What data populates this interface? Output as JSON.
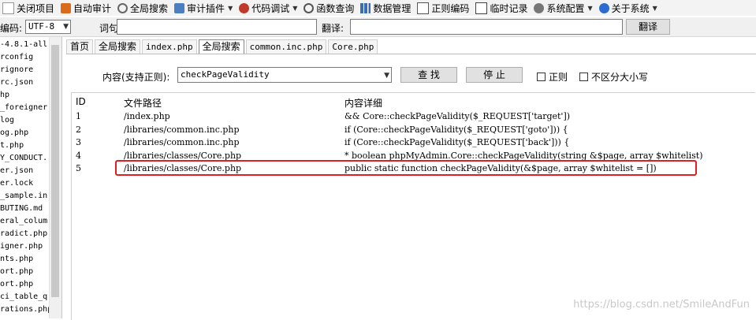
{
  "menu": [
    {
      "label": "关闭项目",
      "icon": "close-project-icon",
      "caret": false
    },
    {
      "label": "自动审计",
      "icon": "auto-audit-icon",
      "caret": false
    },
    {
      "label": "全局搜索",
      "icon": "global-search-icon",
      "caret": false
    },
    {
      "label": "审计插件",
      "icon": "plugin-icon",
      "caret": true
    },
    {
      "label": "代码调试",
      "icon": "code-debug-icon",
      "caret": true
    },
    {
      "label": "函数查询",
      "icon": "function-search-icon",
      "caret": false
    },
    {
      "label": "数据管理",
      "icon": "data-manage-icon",
      "caret": false
    },
    {
      "label": "正则编码",
      "icon": "regex-icon",
      "caret": false
    },
    {
      "label": "临时记录",
      "icon": "notes-icon",
      "caret": false
    },
    {
      "label": "系统配置",
      "icon": "gear-icon",
      "caret": true
    },
    {
      "label": "关于系统",
      "icon": "info-icon",
      "caret": true
    }
  ],
  "toolbar": {
    "encoding_label": "编码:",
    "encoding_value": "UTF-8",
    "word_label": "词句:",
    "translate_label": "翻译:",
    "translate_button": "翻译"
  },
  "sidebar": {
    "files": [
      "-4.8.1-all",
      "rconfig",
      "rignore",
      "rc.json",
      "hp",
      "_foreigner",
      "log",
      "og.php",
      "t.php",
      "Y_CONDUCT.r",
      "er.json",
      "er.lock",
      "_sample.in",
      "BUTING.md",
      "eral_colum",
      "radict.php",
      "igner.php",
      "nts.php",
      "ort.php",
      "ort.php",
      "ci_table_q",
      "rations.php"
    ]
  },
  "tabs": [
    {
      "label": "首页",
      "mono": false,
      "active": false
    },
    {
      "label": "全局搜索",
      "mono": false,
      "active": false
    },
    {
      "label": "index.php",
      "mono": true,
      "active": false
    },
    {
      "label": "全局搜索",
      "mono": false,
      "active": true
    },
    {
      "label": "common.inc.php",
      "mono": true,
      "active": false
    },
    {
      "label": "Core.php",
      "mono": true,
      "active": false
    }
  ],
  "search": {
    "content_label": "内容(支持正则):",
    "query": "checkPageValidity",
    "find_button": "查 找",
    "stop_button": "停 止",
    "regex_label": "正则",
    "ignore_case_label": "不区分大小写"
  },
  "results": {
    "headers": {
      "id": "ID",
      "path": "文件路径",
      "detail": "内容详细"
    },
    "rows": [
      {
        "id": "1",
        "path": "/index.php",
        "detail": "&& Core::checkPageValidity($_REQUEST['target'])"
      },
      {
        "id": "2",
        "path": "/libraries/common.inc.php",
        "detail": "if (Core::checkPageValidity($_REQUEST['goto'])) {"
      },
      {
        "id": "3",
        "path": "/libraries/common.inc.php",
        "detail": "if (Core::checkPageValidity($_REQUEST['back'])) {"
      },
      {
        "id": "4",
        "path": "/libraries/classes/Core.php",
        "detail": "* boolean phpMyAdmin.Core::checkPageValidity(string &$page, array $whitelist)"
      },
      {
        "id": "5",
        "path": "/libraries/classes/Core.php",
        "detail": "public static function checkPageValidity(&$page, array $whitelist = [])"
      }
    ]
  },
  "watermark": "https://blog.csdn.net/SmileAndFun",
  "colors": {
    "highlight": "#e02020",
    "toolbar": "#f0f0f0"
  }
}
